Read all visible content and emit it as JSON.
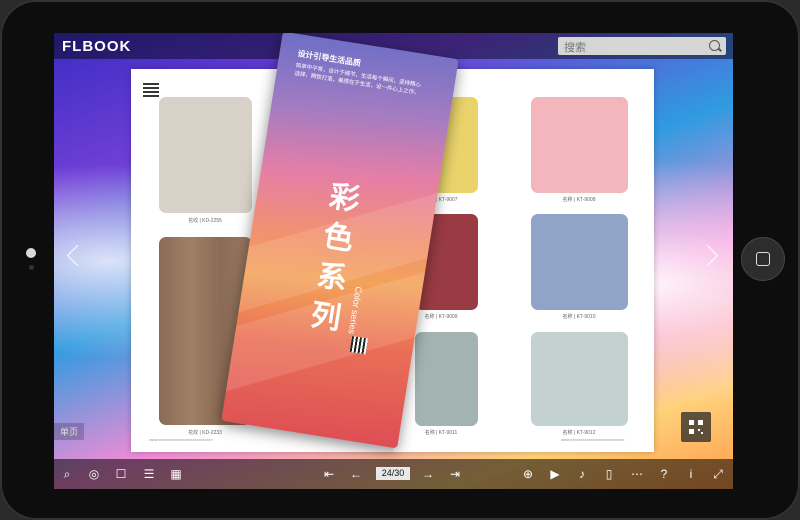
{
  "app": {
    "logo": "FLBOOK"
  },
  "search": {
    "placeholder": "搜索"
  },
  "left_page": {
    "captions": [
      "花纹 | KD-2255",
      "花纹 | KD-2233"
    ],
    "footer": "www.xxxxxxxxxxxxxxxxxxxxxxxxxxx"
  },
  "right_page": {
    "captions": [
      "名称 | KT-9007",
      "名称 | KT-9008",
      "名称 | KT-9009",
      "名称 | KT-9010",
      "名称 | KT-9011",
      "名称 | KT-9012"
    ],
    "footer": "www.xxxxxxxxxxxxxxxxxxxxxxxxxxx"
  },
  "brochure": {
    "title": "设计引导生活品质",
    "text": "简单中平常，设计于细节，生活每个瞬间，坚持精心选择，精致打造，美感在于生活，设一件心上之作。",
    "chars": [
      "彩",
      "色",
      "系",
      "列"
    ],
    "subtitle": "Color series"
  },
  "badge": {
    "label": "单页"
  },
  "pagination": {
    "current": "24/30"
  },
  "colors": {
    "swatches_left": [
      "#d8d1c7",
      "#8b6b55"
    ],
    "swatches_right": [
      "#e9d36a",
      "#f3b6bd",
      "#9a3b43",
      "#8fa4c6",
      "#a3b3b1",
      "#c3d1d1"
    ],
    "dark_swatch": "#3b3532"
  },
  "icons": [
    "search-icon",
    "globe-icon",
    "comment-icon",
    "document-icon",
    "grid-icon",
    "first-page-icon",
    "prev-page-icon",
    "next-page-icon",
    "last-page-icon",
    "zoom-in-icon",
    "play-icon",
    "sound-icon",
    "book-icon",
    "share-icon",
    "help-icon",
    "info-icon",
    "fullscreen-icon"
  ]
}
